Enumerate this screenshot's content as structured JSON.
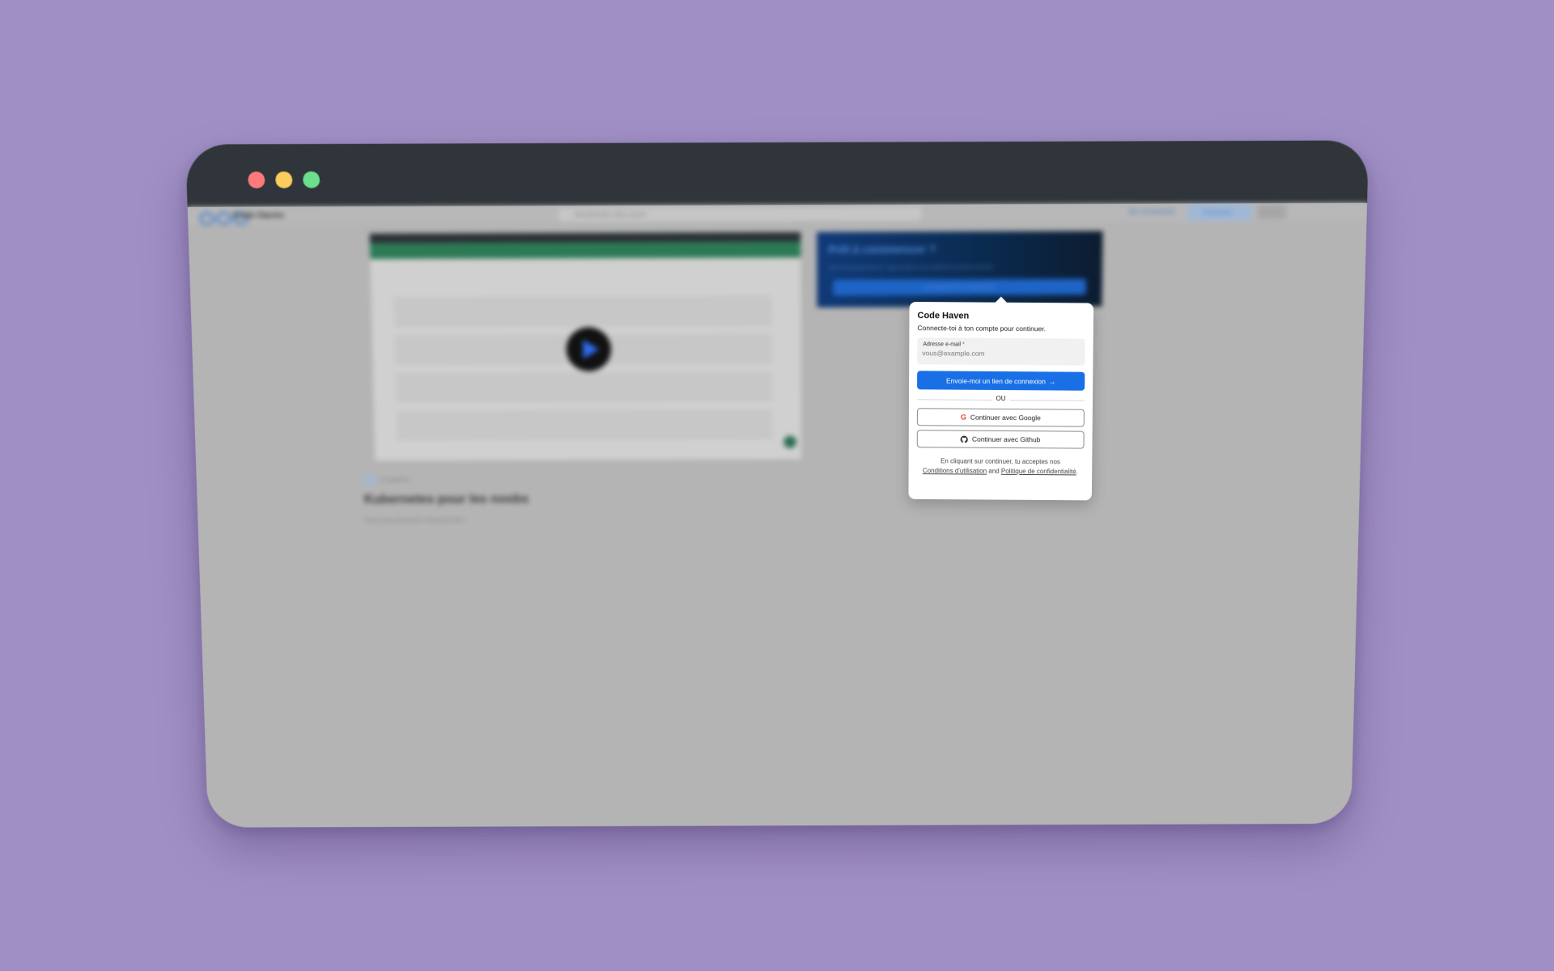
{
  "browser": {
    "traffic_lights": {
      "close": "#fd7a7a",
      "minimize": "#fbcd5c",
      "maximize": "#6bdf8c"
    }
  },
  "background_app": {
    "logo_text": "Code Haven",
    "search_placeholder": "Rechercher des cours",
    "nav_link": "Se connecter",
    "nav_button": "S'inscrire",
    "cta": {
      "title": "Prêt à commencer ?",
      "subtitle": "Suis ta progression, apprends à ton rythme et plus encore",
      "button": "Connecte-toi / Inscris-toi"
    },
    "course": {
      "tag": "5 chapitres",
      "title": "Kubernetes pour les noobs",
      "description": "Parce que personne comprend rien"
    }
  },
  "login": {
    "title": "Code Haven",
    "subtitle": "Connecte-toi à ton compte pour continuer.",
    "email_label": "Adresse e-mail",
    "email_required": "*",
    "email_placeholder": "vous@example.com",
    "magic_link_button": "Envoie-moi un lien de connexion",
    "arrow": "→",
    "divider": "OU",
    "google_button": "Continuer avec Google",
    "github_button": "Continuer avec Github",
    "legal_prefix": "En cliquant sur continuer, tu acceptes nos",
    "terms_link": "Conditions d'utilisation",
    "legal_and": "and",
    "privacy_link": "Politique de confidentialité",
    "legal_suffix": ".",
    "accent_color": "#1970e6"
  }
}
